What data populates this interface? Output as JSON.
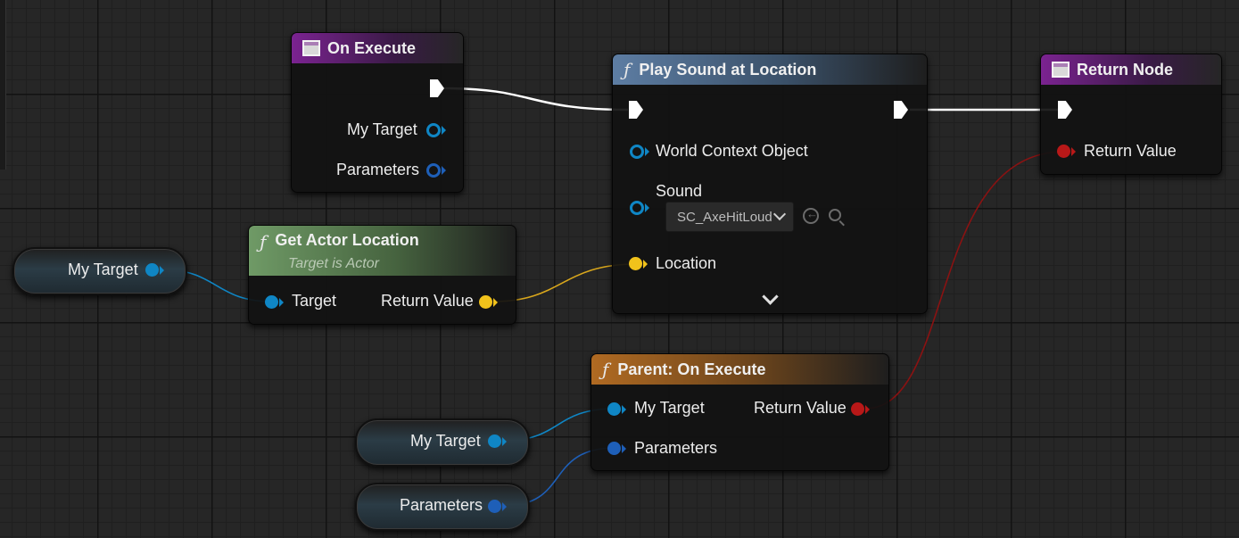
{
  "colors": {
    "exec": "#ffffff",
    "object_pin": "#0f86c5",
    "struct_pin": "#1e5fb8",
    "vector_pin": "#f1c21b",
    "return_pin": "#b81818",
    "event_header": "#7b2391",
    "function_header": "#5d7da3",
    "pure_header": "#6f9a66",
    "parent_header": "#b06a22"
  },
  "nodes": {
    "on_execute": {
      "title": "On Execute",
      "icon": "event-icon",
      "pins": {
        "my_target": "My Target",
        "parameters": "Parameters"
      }
    },
    "play_sound": {
      "title": "Play Sound at Location",
      "icon": "function-icon",
      "pins": {
        "world_context": "World Context Object",
        "sound": "Sound",
        "sound_value": "SC_AxeHitLoud",
        "location": "Location"
      }
    },
    "return_node": {
      "title": "Return Node",
      "icon": "event-icon",
      "pins": {
        "return_value": "Return Value"
      }
    },
    "get_actor_location": {
      "title": "Get Actor Location",
      "subtitle": "Target is Actor",
      "icon": "function-icon",
      "pins": {
        "target": "Target",
        "return_value": "Return Value"
      }
    },
    "parent_on_execute": {
      "title": "Parent: On Execute",
      "icon": "function-icon",
      "pins": {
        "my_target": "My Target",
        "parameters": "Parameters",
        "return_value": "Return Value"
      }
    }
  },
  "variables": {
    "my_target_1": "My Target",
    "my_target_2": "My Target",
    "parameters": "Parameters"
  }
}
